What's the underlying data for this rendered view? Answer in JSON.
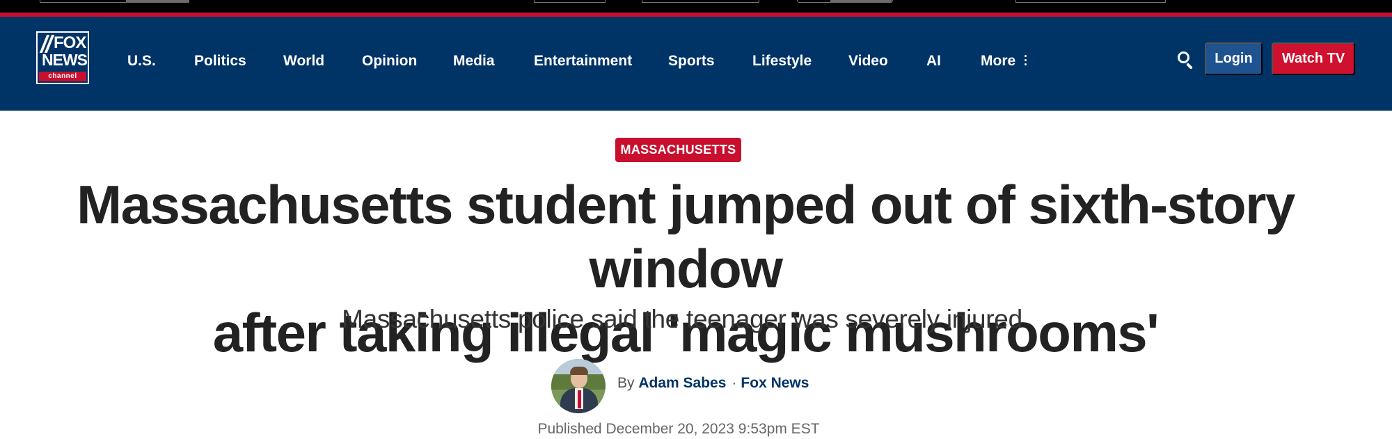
{
  "nav": {
    "logo": {
      "line1": "FOX",
      "line2": "NEWS",
      "line3": "channel"
    },
    "items": [
      "U.S.",
      "Politics",
      "World",
      "Opinion",
      "Media",
      "Entertainment",
      "Sports",
      "Lifestyle",
      "Video",
      "AI",
      "More"
    ],
    "login_label": "Login",
    "watch_label": "Watch TV"
  },
  "article": {
    "category": "MASSACHUSETTS",
    "headline_line1": "Massachusetts student jumped out of sixth-story window",
    "headline_line2": "after taking illegal 'magic mushrooms'",
    "subheadline": "Massachusetts police said the teenager was severely injured",
    "byline_prefix": "By",
    "author": "Adam Sabes",
    "separator": "·",
    "source": "Fox News",
    "published": "Published December 20, 2023 9:53pm EST"
  },
  "colors": {
    "nav_bg": "#003366",
    "accent_red": "#c8102e",
    "login_bg": "#1f5390"
  }
}
